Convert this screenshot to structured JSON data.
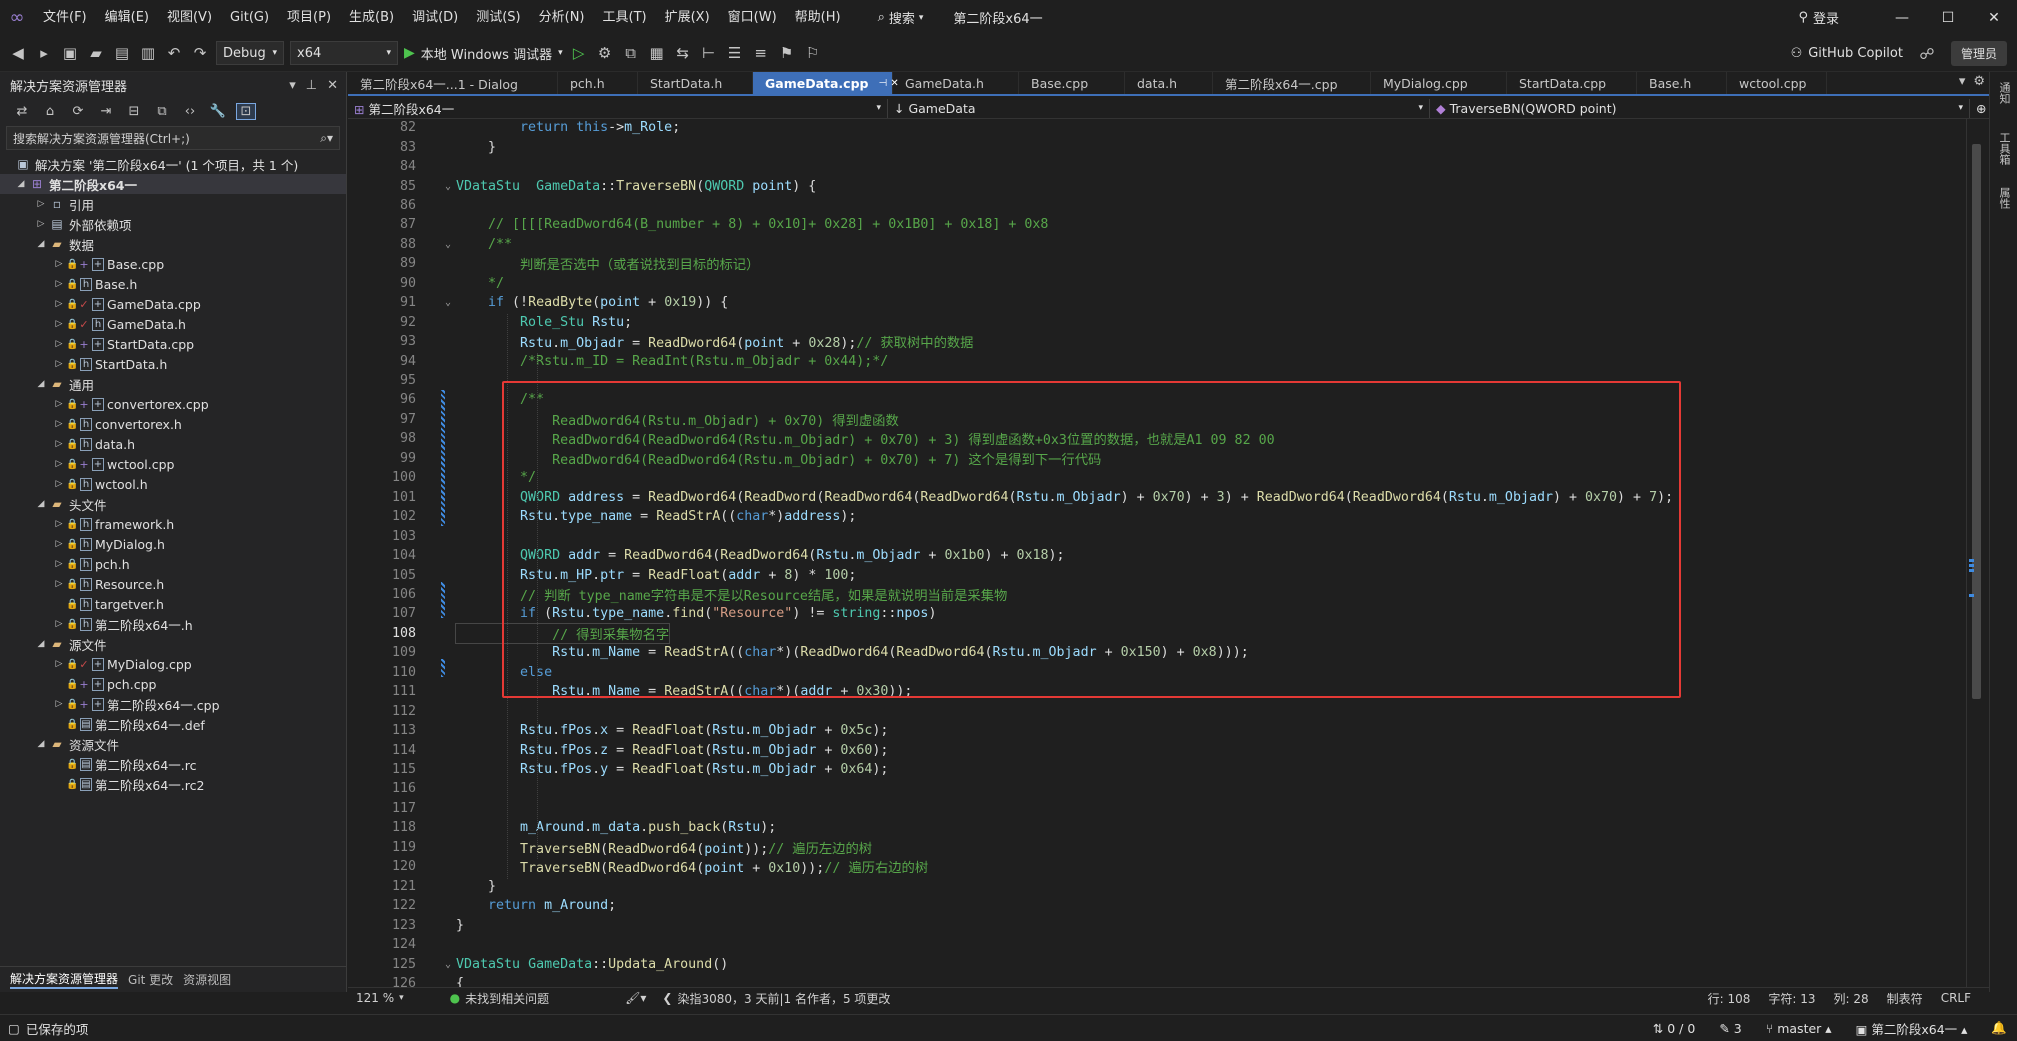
{
  "menu": {
    "items": [
      "文件(F)",
      "编辑(E)",
      "视图(V)",
      "Git(G)",
      "项目(P)",
      "生成(B)",
      "调试(D)",
      "测试(S)",
      "分析(N)",
      "工具(T)",
      "扩展(X)",
      "窗口(W)",
      "帮助(H)"
    ],
    "search": "搜索",
    "solution_name": "第二阶段x64一",
    "login": "登录"
  },
  "toolbar": {
    "config": "Debug",
    "platform": "x64",
    "run_label": "本地 Windows 调试器",
    "copilot": "GitHub Copilot",
    "admin": "管理员"
  },
  "sidebar": {
    "title": "解决方案资源管理器",
    "search_placeholder": "搜索解决方案资源管理器(Ctrl+;)",
    "solution": "解决方案 '第二阶段x64一' (1 个项目，共 1 个)",
    "project": "第二阶段x64一",
    "items": [
      {
        "label": "引用",
        "kind": "ref"
      },
      {
        "label": "外部依赖项",
        "kind": "ext"
      },
      {
        "label": "数据",
        "kind": "folder"
      },
      {
        "label": "Base.cpp",
        "kind": "cpp"
      },
      {
        "label": "Base.h",
        "kind": "h"
      },
      {
        "label": "GameData.cpp",
        "kind": "cpp"
      },
      {
        "label": "GameData.h",
        "kind": "h"
      },
      {
        "label": "StartData.cpp",
        "kind": "cpp"
      },
      {
        "label": "StartData.h",
        "kind": "h"
      },
      {
        "label": "通用",
        "kind": "folder"
      },
      {
        "label": "convertorex.cpp",
        "kind": "cpp"
      },
      {
        "label": "convertorex.h",
        "kind": "h"
      },
      {
        "label": "data.h",
        "kind": "h"
      },
      {
        "label": "wctool.cpp",
        "kind": "cpp"
      },
      {
        "label": "wctool.h",
        "kind": "h"
      },
      {
        "label": "头文件",
        "kind": "folder"
      },
      {
        "label": "framework.h",
        "kind": "h"
      },
      {
        "label": "MyDialog.h",
        "kind": "h"
      },
      {
        "label": "pch.h",
        "kind": "h"
      },
      {
        "label": "Resource.h",
        "kind": "h"
      },
      {
        "label": "targetver.h",
        "kind": "h"
      },
      {
        "label": "第二阶段x64一.h",
        "kind": "h"
      },
      {
        "label": "源文件",
        "kind": "folder"
      },
      {
        "label": "MyDialog.cpp",
        "kind": "cpp"
      },
      {
        "label": "pch.cpp",
        "kind": "cpp"
      },
      {
        "label": "第二阶段x64一.cpp",
        "kind": "cpp"
      },
      {
        "label": "第二阶段x64一.def",
        "kind": "def"
      },
      {
        "label": "资源文件",
        "kind": "folder"
      },
      {
        "label": "第二阶段x64一.rc",
        "kind": "rc"
      },
      {
        "label": "第二阶段x64一.rc2",
        "kind": "rc"
      }
    ],
    "bottom_tabs": [
      "解决方案资源管理器",
      "Git 更改",
      "资源视图"
    ]
  },
  "tabs": [
    "第二阶段x64一...1 - Dialog",
    "pch.h",
    "StartData.h",
    "GameData.cpp",
    "GameData.h",
    "Base.cpp",
    "data.h",
    "第二阶段x64一.cpp",
    "MyDialog.cpp",
    "StartData.cpp",
    "Base.h",
    "wctool.cpp"
  ],
  "nav": {
    "project": "第二阶段x64一",
    "scope": "GameData",
    "member": "TraverseBN(QWORD point)"
  },
  "code": {
    "lines": [
      {
        "n": 82,
        "h": "        <k>return</k> <k>this</k>-&gt;<v>m_Role</v>;"
      },
      {
        "n": 83,
        "h": "    }"
      },
      {
        "n": 84,
        "h": ""
      },
      {
        "n": 85,
        "h": "<t>VDataStu</t>  <t>GameData</t>::<f>TraverseBN</f>(<t>QWORD</t> <v>point</v>) {"
      },
      {
        "n": 86,
        "h": ""
      },
      {
        "n": 87,
        "h": "    <c>// [[[[ReadDword64(B_number + 8) + 0x10]+ 0x28] + 0x1B0] + 0x18] + 0x8</c>"
      },
      {
        "n": 88,
        "h": "    <c>/**</c>"
      },
      {
        "n": 89,
        "h": "    <c>    判断是否选中（或者说找到目标的标记）</c>"
      },
      {
        "n": 90,
        "h": "    <c>*/</c>"
      },
      {
        "n": 91,
        "h": "    <k>if</k> (!<f>ReadByte</f>(<v>point</v> + <n>0x19</n>)) {"
      },
      {
        "n": 92,
        "h": "        <t>Role_Stu</t> <v>Rstu</v>;"
      },
      {
        "n": 93,
        "h": "        <v>Rstu</v>.<v>m_Objadr</v> = <f>ReadDword64</f>(<v>point</v> + <n>0x28</n>);<c>// 获取树中的数据</c>"
      },
      {
        "n": 94,
        "h": "        <c>/*Rstu.m_ID = ReadInt(Rstu.m_Objadr + 0x44);*/</c>"
      },
      {
        "n": 95,
        "h": ""
      },
      {
        "n": 96,
        "h": "        <c>/**</c>"
      },
      {
        "n": 97,
        "h": "        <c>    ReadDword64(Rstu.m_Objadr) + 0x70) 得到虚函数</c>"
      },
      {
        "n": 98,
        "h": "        <c>    ReadDword64(ReadDword64(Rstu.m_Objadr) + 0x70) + 3) 得到虚函数+0x3位置的数据，也就是A1 09 82 00</c>"
      },
      {
        "n": 99,
        "h": "        <c>    ReadDword64(ReadDword64(Rstu.m_Objadr) + 0x70) + 7) 这个是得到下一行代码</c>"
      },
      {
        "n": 100,
        "h": "        <c>*/</c>"
      },
      {
        "n": 101,
        "h": "        <t>QWORD</t> <v>address</v> = <f>ReadDword64</f>(<f>ReadDword</f>(<f>ReadDword64</f>(<f>ReadDword64</f>(<v>Rstu</v>.<v>m_Objadr</v>) + <n>0x70</n>) + <n>3</n>) + <f>ReadDword64</f>(<f>ReadDword64</f>(<v>Rstu</v>.<v>m_Objadr</v>) + <n>0x70</n>) + <n>7</n>);"
      },
      {
        "n": 102,
        "h": "        <v>Rstu</v>.<v>type_name</v> = <f>ReadStrA</f>((<k>char</k>*)<v>address</v>);"
      },
      {
        "n": 103,
        "h": ""
      },
      {
        "n": 104,
        "h": "        <t>QWORD</t> <v>addr</v> = <f>ReadDword64</f>(<f>ReadDword64</f>(<v>Rstu</v>.<v>m_Objadr</v> + <n>0x1b0</n>) + <n>0x18</n>);"
      },
      {
        "n": 105,
        "h": "        <v>Rstu</v>.<v>m_HP</v>.<v>ptr</v> = <f>ReadFloat</f>(<v>addr</v> + <n>8</n>) * <n>100</n>;"
      },
      {
        "n": 106,
        "h": "        <c>// 判断 type_name字符串是不是以Resource结尾，如果是就说明当前是采集物</c>"
      },
      {
        "n": 107,
        "h": "        <k>if</k> (<v>Rstu</v>.<v>type_name</v>.<f>find</f>(<s>\"Resource\"</s>) != <t>string</t>::<v>npos</v>)"
      },
      {
        "n": 108,
        "h": "            <c>// 得到采集物名字</c>"
      },
      {
        "n": 109,
        "h": "            <v>Rstu</v>.<v>m_Name</v> = <f>ReadStrA</f>((<k>char</k>*)(<f>ReadDword64</f>(<f>ReadDword64</f>(<v>Rstu</v>.<v>m_Objadr</v> + <n>0x150</n>) + <n>0x8</n>)));"
      },
      {
        "n": 110,
        "h": "        <k>else</k>"
      },
      {
        "n": 111,
        "h": "            <v>Rstu</v>.<v>m_Name</v> = <f>ReadStrA</f>((<k>char</k>*)(<v>addr</v> + <n>0x30</n>));"
      },
      {
        "n": 112,
        "h": ""
      },
      {
        "n": 113,
        "h": "        <v>Rstu</v>.<v>fPos</v>.<v>x</v> = <f>ReadFloat</f>(<v>Rstu</v>.<v>m_Objadr</v> + <n>0x5c</n>);"
      },
      {
        "n": 114,
        "h": "        <v>Rstu</v>.<v>fPos</v>.<v>z</v> = <f>ReadFloat</f>(<v>Rstu</v>.<v>m_Objadr</v> + <n>0x60</n>);"
      },
      {
        "n": 115,
        "h": "        <v>Rstu</v>.<v>fPos</v>.<v>y</v> = <f>ReadFloat</f>(<v>Rstu</v>.<v>m_Objadr</v> + <n>0x64</n>);"
      },
      {
        "n": 116,
        "h": ""
      },
      {
        "n": 117,
        "h": ""
      },
      {
        "n": 118,
        "h": "        <v>m_Around</v>.<v>m_data</v>.<f>push_back</f>(<v>Rstu</v>);"
      },
      {
        "n": 119,
        "h": "        <f>TraverseBN</f>(<f>ReadDword64</f>(<v>point</v>));<c>// 遍历左边的树</c>"
      },
      {
        "n": 120,
        "h": "        <f>TraverseBN</f>(<f>ReadDword64</f>(<v>point</v> + <n>0x10</n>));<c>// 遍历右边的树</c>"
      },
      {
        "n": 121,
        "h": "    }"
      },
      {
        "n": 122,
        "h": "    <k>return</k> <v>m_Around</v>;"
      },
      {
        "n": 123,
        "h": "}"
      },
      {
        "n": 124,
        "h": ""
      },
      {
        "n": 125,
        "h": "<t>VDataStu</t> <t>GameData</t>::<f>Updata_Around</f>()"
      },
      {
        "n": 126,
        "h": "{"
      }
    ]
  },
  "editor_status": {
    "zoom": "121 %",
    "issues": "未找到相关问题",
    "codelens": "染指3080，3 天前|1 名作者，5 项更改",
    "line": "行: 108",
    "char": "字符: 13",
    "col": "列: 28",
    "tabs": "制表符",
    "eol": "CRLF"
  },
  "status": {
    "saved": "已保存的项",
    "sync": "0 / 0",
    "edits": "3",
    "branch": "master",
    "repo": "第二阶段x64一"
  },
  "right_strip": [
    "通知",
    "工具箱",
    "属性"
  ]
}
